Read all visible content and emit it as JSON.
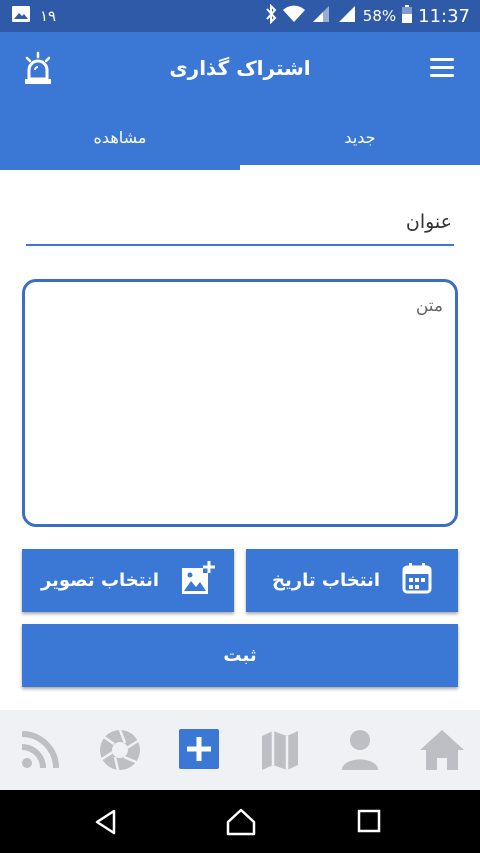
{
  "status_bar": {
    "notification_count": "۱۹",
    "battery": "58%",
    "time": "11:37",
    "icons": [
      "image-icon",
      "bluetooth-icon",
      "wifi-icon",
      "signal-icon",
      "battery-icon"
    ]
  },
  "app_bar": {
    "title": "اشتراک گذاری",
    "menu_icon": "hamburger-menu-icon",
    "alert_icon": "siren-icon"
  },
  "tabs": [
    {
      "label": "جدید",
      "active": true
    },
    {
      "label": "مشاهده",
      "active": false
    }
  ],
  "form": {
    "title_placeholder": "عنوان",
    "text_placeholder": "متن",
    "date_button_label": "انتخاب تاریخ",
    "image_button_label": "انتخاب تصویر",
    "submit_label": "ثبت"
  },
  "bottom_nav": [
    {
      "name": "home",
      "icon": "home-icon"
    },
    {
      "name": "profile",
      "icon": "person-icon"
    },
    {
      "name": "map",
      "icon": "map-icon"
    },
    {
      "name": "add",
      "icon": "plus-icon",
      "active": true
    },
    {
      "name": "camera",
      "icon": "aperture-icon"
    },
    {
      "name": "feed",
      "icon": "rss-icon"
    }
  ],
  "colors": {
    "primary": "#3b78d6",
    "status_bar": "#2e5aa8",
    "nav_background": "#f0f1f4",
    "nav_icon_inactive": "#bdbfc4"
  }
}
